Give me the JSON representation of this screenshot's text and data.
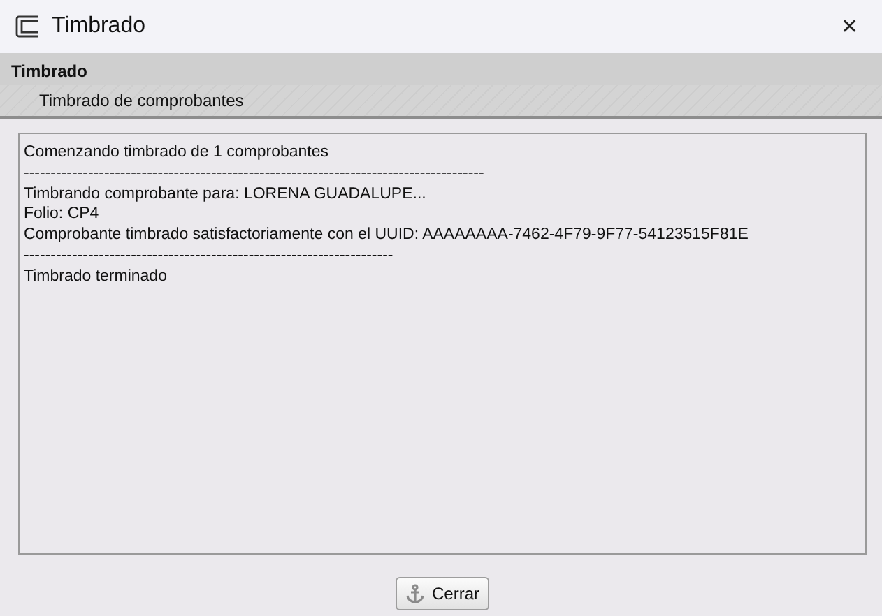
{
  "window": {
    "title": "Timbrado",
    "close": "✕"
  },
  "header": {
    "title": "Timbrado",
    "subtitle": "Timbrado de comprobantes"
  },
  "log": {
    "lines": [
      "Comenzando timbrado de 1 comprobantes",
      "--------------------------------------------------------------------------------------",
      "Timbrando comprobante para: LORENA GUADALUPE...",
      "Folio: CP4",
      "Comprobante timbrado satisfactoriamente con el UUID: AAAAAAAA-7462-4F79-9F77-54123515F81E",
      "---------------------------------------------------------------------",
      "Timbrado terminado"
    ]
  },
  "buttons": [
    {
      "label": "Cerrar"
    }
  ]
}
